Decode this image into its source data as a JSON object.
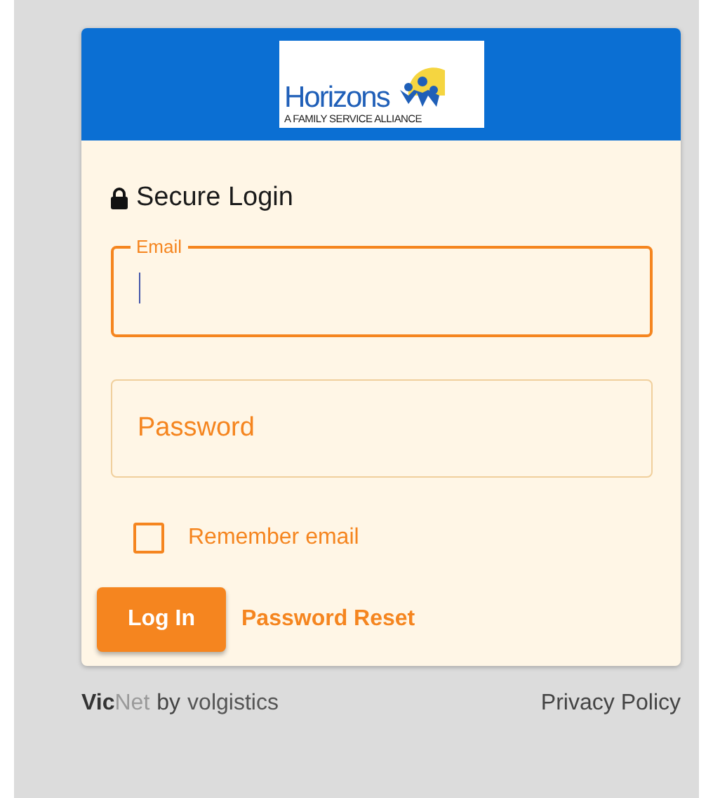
{
  "logo": {
    "name": "Horizons",
    "tagline": "A FAMILY SERVICE ALLIANCE"
  },
  "heading": "Secure Login",
  "fields": [
    {
      "label": "Email",
      "focused": true
    },
    {
      "label": "Password",
      "focused": false
    }
  ],
  "remember": {
    "label": "Remember email",
    "checked": false
  },
  "login_button": "Log In",
  "reset_link": "Password Reset",
  "footer": {
    "product": "**Vic**Net",
    "by": "by",
    "vendor": "volgistics",
    "privacy": "Privacy Policy"
  }
}
